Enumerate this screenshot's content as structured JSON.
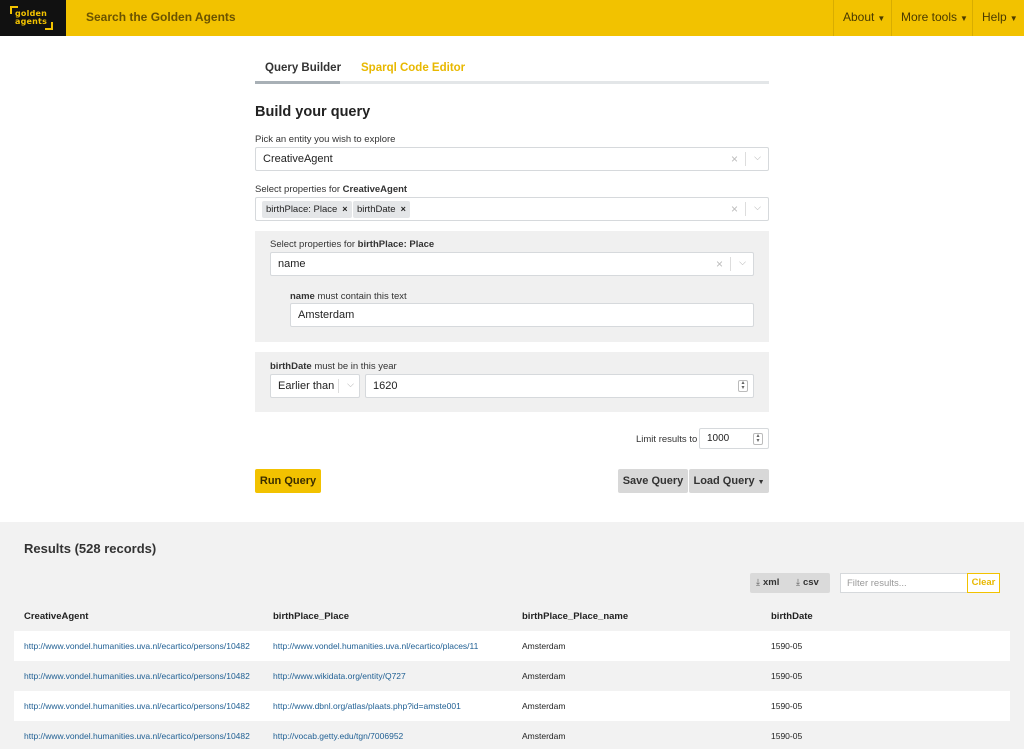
{
  "header": {
    "logo_text_1": "golden",
    "logo_text_2": "agents",
    "site_title": "Search the Golden Agents",
    "nav": [
      {
        "label": "About"
      },
      {
        "label": "More tools"
      },
      {
        "label": "Help"
      }
    ],
    "caret": "⌄"
  },
  "tabs": [
    {
      "label": "Query Builder",
      "active": true
    },
    {
      "label": "Sparql Code Editor",
      "active": false
    }
  ],
  "builder": {
    "title": "Build your query",
    "entity_label": "Pick an entity you wish to explore",
    "entity_value": "CreativeAgent",
    "props_label_prefix": "Select properties for ",
    "props_label_entity": "CreativeAgent",
    "chips": [
      "birthPlace: Place",
      "birthDate"
    ],
    "place_panel": {
      "label_prefix": "Select properties for ",
      "label_entity": "birthPlace: Place",
      "select_value": "name",
      "cond_field": "name",
      "cond_text": " must contain this text",
      "cond_value": "Amsterdam"
    },
    "date_panel": {
      "field": "birthDate",
      "text": " must be in this year",
      "operator": "Earlier than",
      "year": "1620"
    },
    "limit_label": "Limit results to",
    "limit_value": "1000",
    "run_label": "Run Query",
    "save_label": "Save Query",
    "load_label": "Load Query"
  },
  "results": {
    "title": "Results (528 records)",
    "xml_label": "xml",
    "csv_label": "csv",
    "filter_placeholder": "Filter results...",
    "clear_label": "Clear",
    "columns": [
      "CreativeAgent",
      "birthPlace_Place",
      "birthPlace_Place_name",
      "birthDate"
    ],
    "rows": [
      [
        "http://www.vondel.humanities.uva.nl/ecartico/persons/10482",
        "http://www.vondel.humanities.uva.nl/ecartico/places/11",
        "Amsterdam",
        "1590-05"
      ],
      [
        "http://www.vondel.humanities.uva.nl/ecartico/persons/10482",
        "http://www.wikidata.org/entity/Q727",
        "Amsterdam",
        "1590-05"
      ],
      [
        "http://www.vondel.humanities.uva.nl/ecartico/persons/10482",
        "http://www.dbnl.org/atlas/plaats.php?id=amste001",
        "Amsterdam",
        "1590-05"
      ],
      [
        "http://www.vondel.humanities.uva.nl/ecartico/persons/10482",
        "http://vocab.getty.edu/tgn/7006952",
        "Amsterdam",
        "1590-05"
      ]
    ]
  }
}
